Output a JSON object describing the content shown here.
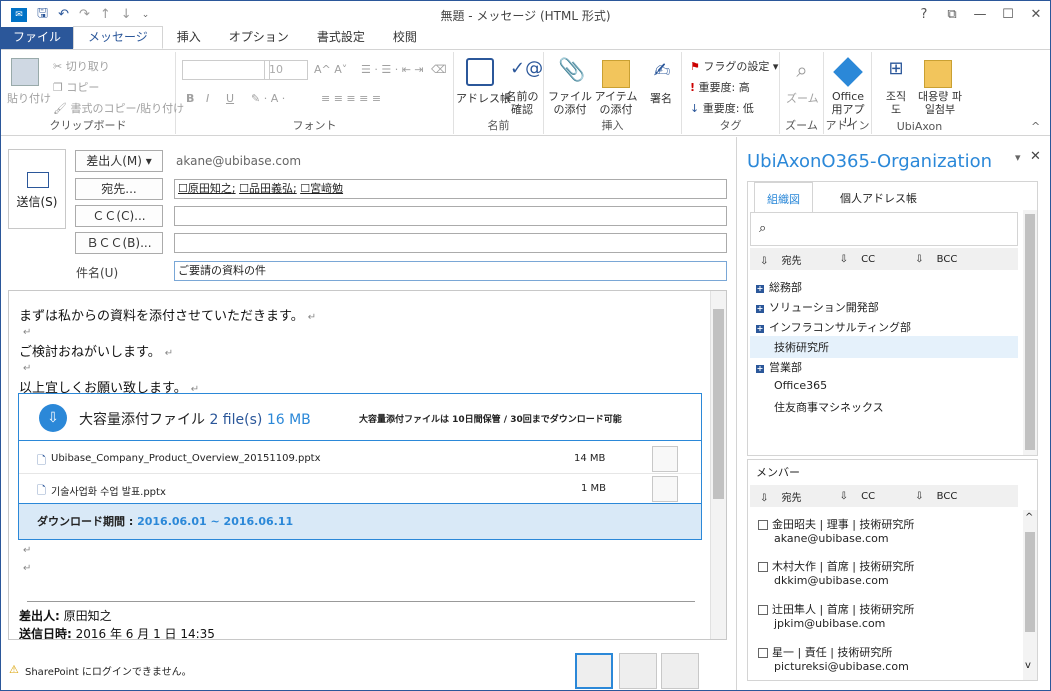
{
  "window": {
    "title": "無題 - メッセージ (HTML 形式)",
    "help": "?",
    "restore": "⧉",
    "minimize": "—",
    "maximize": "☐",
    "close": "✕"
  },
  "tabs": [
    "ファイル",
    "メッセージ",
    "挿入",
    "オプション",
    "書式設定",
    "校閲"
  ],
  "ribbon": {
    "clipboard": {
      "paste": "貼り付け",
      "cut": "切り取り",
      "copy": "コピー",
      "format_copy": "書式のコピー/貼り付け",
      "label": "クリップボード"
    },
    "font": {
      "label": "フォント",
      "size": "10"
    },
    "names": {
      "address_book": "アドレス帳",
      "check_names": "名前の確認",
      "label": "名前"
    },
    "insert": {
      "attach_file": "ファイルの添付",
      "attach_item": "アイテムの添付",
      "signature": "署名",
      "label": "挿入"
    },
    "tags": {
      "flag": "フラグの設定",
      "high": "重要度: 高",
      "low": "重要度: 低",
      "label": "タグ"
    },
    "zoom": {
      "zoom": "ズーム",
      "label": "ズーム"
    },
    "addin": {
      "office": "Office 用アプリ",
      "label": "アドイン"
    },
    "ubiaxon": {
      "org": "조직도",
      "attach": "대용량 파일첨부",
      "label": "UbiAxon"
    }
  },
  "compose": {
    "send": "送信(S)",
    "from_btn": "差出人(M) ▾",
    "from_value": "akane@ubibase.com",
    "to_btn": "宛先...",
    "to_values": [
      "原田知之",
      "品田義弘",
      "宮﨑勉"
    ],
    "cc_btn": "ＣＣ(C)...",
    "bcc_btn": "ＢＣＣ(B)...",
    "subject_label": "件名(U)",
    "subject_value": "ご要請の資料の件"
  },
  "body": {
    "line1": "まずは私からの資料を添付させていただきます。",
    "line2": "ご検討おねがいします。",
    "line3": "以上宜しくお願い致します。",
    "attach_title": "大容量添付ファイル",
    "attach_count": "2 file(s)",
    "attach_size": "16 MB",
    "attach_note": "大容量添付ファイルは 10日間保管 / 30回までダウンロード可能",
    "files": [
      {
        "name": "Ubibase_Company_Product_Overview_20151109.pptx",
        "size": "14 MB"
      },
      {
        "name": "기술사업화 수업 발표.pptx",
        "size": "1 MB"
      }
    ],
    "download_label": "ダウンロード期間 :",
    "download_range": "2016.06.01 ~ 2016.06.11",
    "sender_label": "差出人:",
    "sender_value": "原田知之",
    "sent_label": "送信日時:",
    "sent_value": "2016 年 6 月 1 日  14:35"
  },
  "status": {
    "text": "SharePoint にログインできません。"
  },
  "pane": {
    "title": "UbiAxonO365-Organization",
    "tabs": [
      "組織図",
      "個人アドレス帳"
    ],
    "actions": [
      "宛先",
      "CC",
      "BCC"
    ],
    "tree": [
      {
        "label": "総務部",
        "expandable": true
      },
      {
        "label": "ソリューション開発部",
        "expandable": true
      },
      {
        "label": "インフラコンサルティング部",
        "expandable": true
      },
      {
        "label": "技術研究所",
        "expandable": false,
        "selected": true
      },
      {
        "label": "営業部",
        "expandable": true
      },
      {
        "label": "Office365",
        "expandable": false
      },
      {
        "label": "住友商事マシネックス",
        "expandable": false
      }
    ],
    "members_label": "メンバー",
    "members": [
      {
        "name": "金田昭夫 | 理事 | 技術研究所",
        "email": "akane@ubibase.com"
      },
      {
        "name": "木村大作 | 首席 | 技術研究所",
        "email": "dkkim@ubibase.com"
      },
      {
        "name": "辻田隼人 | 首席 | 技術研究所",
        "email": "jpkim@ubibase.com"
      },
      {
        "name": "星一 | 責任 | 技術研究所",
        "email": "pictureksi@ubibase.com"
      }
    ]
  }
}
